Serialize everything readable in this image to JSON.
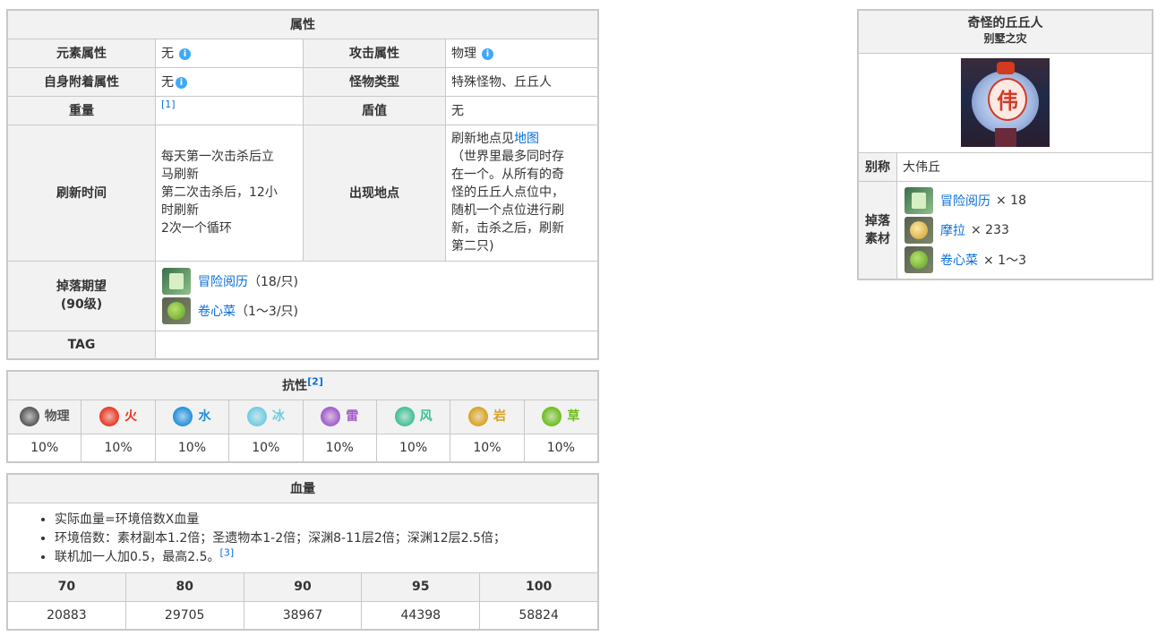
{
  "attr": {
    "title": "属性",
    "element_label": "元素属性",
    "element_value": "无",
    "attack_label": "攻击属性",
    "attack_value": "物理",
    "self_label": "自身附着属性",
    "self_value": "无",
    "type_label": "怪物类型",
    "type_value": "特殊怪物、丘丘人",
    "weight_label": "重量",
    "weight_ref": "[1]",
    "shield_label": "盾值",
    "shield_value": "无",
    "refresh_label": "刷新时间",
    "refresh_lines": [
      "每天第一次击杀后立",
      "马刷新",
      "第二次击杀后，12小",
      "时刷新",
      "2次一个循环"
    ],
    "location_label": "出现地点",
    "location_prefix": "刷新地点见",
    "location_link": "地图",
    "location_lines": [
      "（世界里最多同时存",
      "在一个。从所有的奇",
      "怪的丘丘人点位中，",
      "随机一个点位进行刷",
      "新，击杀之后，刷新",
      "第二只)"
    ],
    "drop_label_1": "掉落期望",
    "drop_label_2": "(90级)",
    "drops": [
      {
        "icon": "adventure-exp-icon",
        "name": "冒险阅历",
        "qty": "（18/只)"
      },
      {
        "icon": "cabbage-icon",
        "name": "卷心菜",
        "qty": "（1～3/只)"
      }
    ],
    "tag_label": "TAG"
  },
  "resist": {
    "title": "抗性",
    "ref": "[2]",
    "elements": [
      {
        "name": "物理",
        "icon": "physical-icon",
        "color": "#555555",
        "value": "10%"
      },
      {
        "name": "火",
        "icon": "pyro-icon",
        "color": "#e8361f",
        "value": "10%"
      },
      {
        "name": "水",
        "icon": "hydro-icon",
        "color": "#1e8fdc",
        "value": "10%"
      },
      {
        "name": "冰",
        "icon": "cryo-icon",
        "color": "#6fcbe0",
        "value": "10%"
      },
      {
        "name": "雷",
        "icon": "electro-icon",
        "color": "#a05ac8",
        "value": "10%"
      },
      {
        "name": "风",
        "icon": "anemo-icon",
        "color": "#3dbf94",
        "value": "10%"
      },
      {
        "name": "岩",
        "icon": "geo-icon",
        "color": "#d8a21f",
        "value": "10%"
      },
      {
        "name": "草",
        "icon": "dendro-icon",
        "color": "#6cbc1a",
        "value": "10%"
      }
    ]
  },
  "hp": {
    "title": "血量",
    "notes": [
      "实际血量=环境倍数X血量",
      "环境倍数：素材副本1.2倍；圣遗物本1-2倍；深渊8-11层2倍；深渊12层2.5倍；",
      "联机加一人加0.5，最高2.5。"
    ],
    "note_ref": "[3]",
    "levels": [
      "70",
      "80",
      "90",
      "95",
      "100"
    ],
    "values": [
      "20883",
      "29705",
      "38967",
      "44398",
      "58824"
    ]
  },
  "card": {
    "title": "奇怪的丘丘人",
    "subtitle": "别墅之灾",
    "portrait_char": "伟",
    "alias_label": "别称",
    "alias_value": "大伟丘",
    "drop_label_1": "掉落",
    "drop_label_2": "素材",
    "drops": [
      {
        "icon": "adventure-exp-icon",
        "name": "冒险阅历",
        "qty": "× 18"
      },
      {
        "icon": "mora-icon",
        "name": "摩拉",
        "qty": "× 233"
      },
      {
        "icon": "cabbage-icon",
        "name": "卷心菜",
        "qty": "× 1～3"
      }
    ]
  }
}
